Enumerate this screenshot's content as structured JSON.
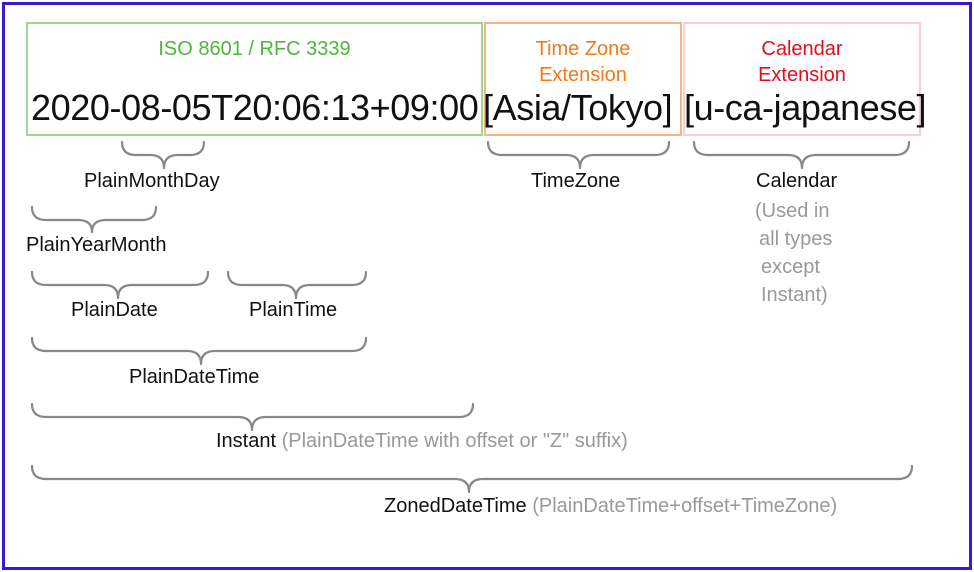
{
  "colors": {
    "frame": "#3a18d6",
    "iso": "#4fb43f",
    "timezone": "#f07a1e",
    "calendar": "#e0101e",
    "brace": "#888888",
    "note": "#999999"
  },
  "segments": {
    "iso": {
      "header": "ISO 8601 / RFC 3339",
      "value": "2020-08-05T20:06:13+09:00"
    },
    "timezone": {
      "header_line1": "Time Zone",
      "header_line2": "Extension",
      "value": "[Asia/Tokyo]"
    },
    "calendar": {
      "header_line1": "Calendar",
      "header_line2": "Extension",
      "value": "[u-ca-japanese]"
    }
  },
  "types": {
    "plain_month_day": "PlainMonthDay",
    "plain_year_month": "PlainYearMonth",
    "plain_date": "PlainDate",
    "plain_time": "PlainTime",
    "plain_date_time": "PlainDateTime",
    "instant": {
      "name": "Instant",
      "note": "(PlainDateTime with offset or \"Z\" suffix)"
    },
    "zoned_date_time": {
      "name": "ZonedDateTime",
      "note": "(PlainDateTime+offset+TimeZone)"
    },
    "time_zone": "TimeZone",
    "calendar": {
      "name": "Calendar",
      "note_lines": [
        "(Used in",
        "all types",
        "except",
        "Instant)"
      ]
    }
  }
}
